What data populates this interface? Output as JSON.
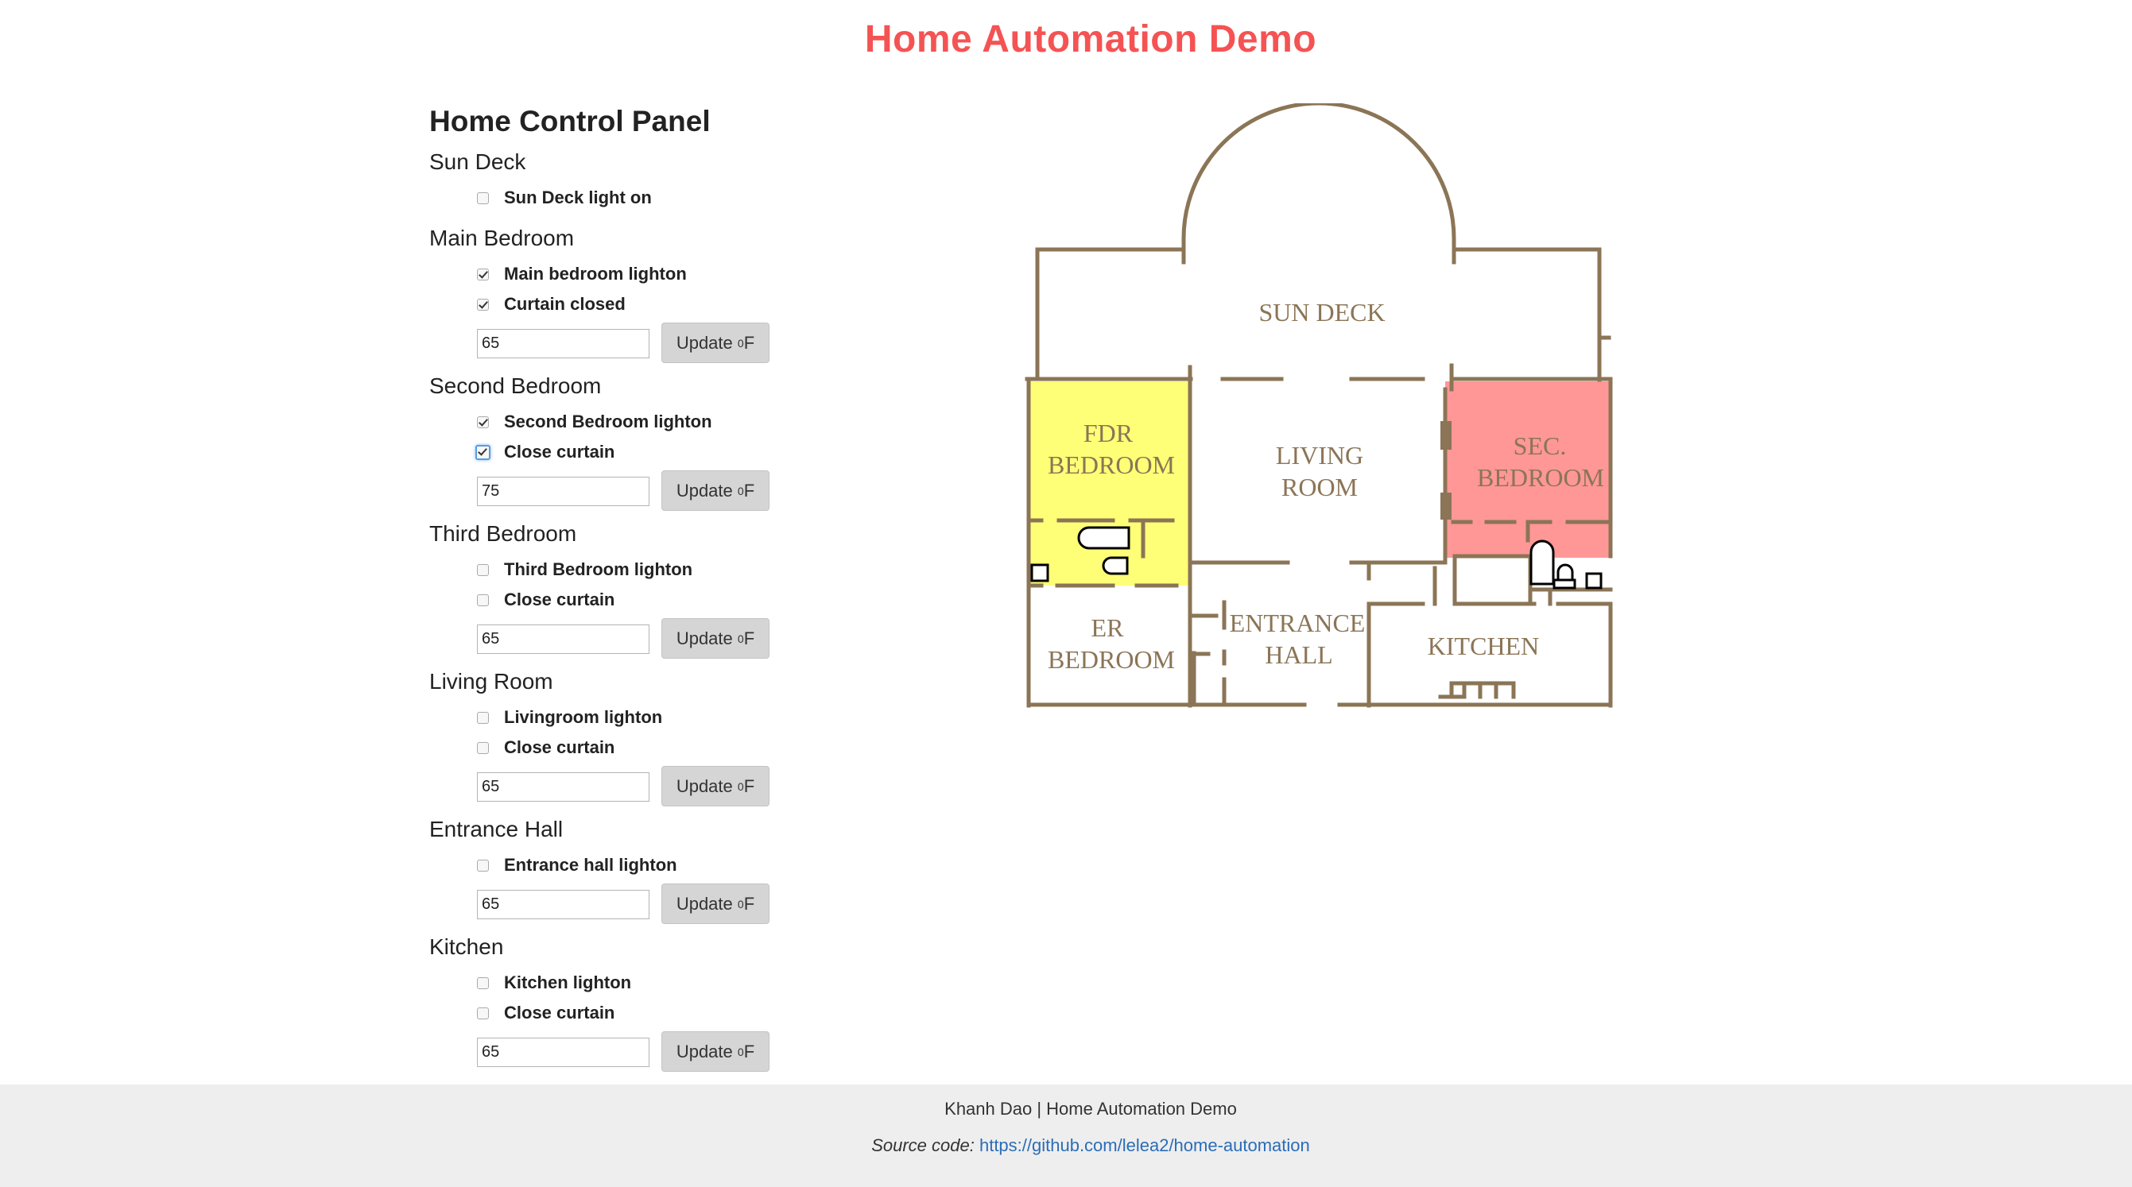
{
  "page": {
    "title": "Home Automation Demo"
  },
  "panel": {
    "heading": "Home Control Panel",
    "update_label": "Update",
    "degree_sup": "0",
    "unit": "F",
    "rooms": [
      {
        "title": "Sun Deck",
        "checks": [
          {
            "label": "Sun Deck light on",
            "checked": false
          }
        ]
      },
      {
        "title": "Main Bedroom",
        "checks": [
          {
            "label": "Main bedroom lighton",
            "checked": true
          },
          {
            "label": "Curtain closed",
            "checked": true
          }
        ],
        "temp": "65"
      },
      {
        "title": "Second Bedroom",
        "checks": [
          {
            "label": "Second Bedroom lighton",
            "checked": true
          },
          {
            "label": "Close curtain",
            "checked": true,
            "focused": true
          }
        ],
        "temp": "75"
      },
      {
        "title": "Third Bedroom",
        "checks": [
          {
            "label": "Third Bedroom lighton",
            "checked": false
          },
          {
            "label": "Close curtain",
            "checked": false
          }
        ],
        "temp": "65"
      },
      {
        "title": "Living Room",
        "checks": [
          {
            "label": "Livingroom lighton",
            "checked": false
          },
          {
            "label": "Close curtain",
            "checked": false
          }
        ],
        "temp": "65"
      },
      {
        "title": "Entrance Hall",
        "checks": [
          {
            "label": "Entrance hall lighton",
            "checked": false
          }
        ],
        "temp": "65"
      },
      {
        "title": "Kitchen",
        "checks": [
          {
            "label": "Kitchen lighton",
            "checked": false
          },
          {
            "label": "Close curtain",
            "checked": false
          }
        ],
        "temp": "65"
      }
    ]
  },
  "floorplan": {
    "wall_color": "#8b7556",
    "label_color": "#8b7556",
    "highlight_main": "#ffff77",
    "highlight_second": "#ff9797",
    "labels": {
      "sun_deck": "SUN DECK",
      "fdr_1": "FDR",
      "fdr_2": "BEDROOM",
      "living_1": "LIVING",
      "living_2": "ROOM",
      "sec_1": "SEC.",
      "sec_2": "BEDROOM",
      "er_1": "ER",
      "er_2": "BEDROOM",
      "entrance_1": "ENTRANCE",
      "entrance_2": "HALL",
      "kitchen": "KITCHEN"
    }
  },
  "footer": {
    "credit": "Khanh Dao | Home Automation Demo",
    "source_label": "Source code:",
    "source_link": "https://github.com/lelea2/home-automation"
  }
}
